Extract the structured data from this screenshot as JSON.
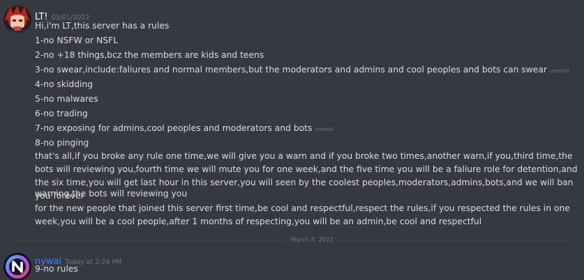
{
  "messages": [
    {
      "author": "LT!",
      "timestamp": "03/01/2022",
      "lines": [
        {
          "text": "Hi,i'm LT,this server has a rules",
          "edited": ""
        },
        {
          "text": "1-no NSFW or NSFL",
          "edited": ""
        },
        {
          "text": "2-no +18 things,bcz the members are kids and teens",
          "edited": ""
        },
        {
          "text": "3-no swear,include:faliures and normal members,but the moderators and admins and cool peoples and bots can swear",
          "edited": "(edited)"
        },
        {
          "text": "4-no skidding",
          "edited": ""
        },
        {
          "text": "5-no malwares",
          "edited": ""
        },
        {
          "text": "6-no trading",
          "edited": ""
        },
        {
          "text": "7-no exposing for admins,cool peoples and moderators and bots",
          "edited": "(edited)"
        },
        {
          "text": "8-no pinging",
          "edited": ""
        },
        {
          "text": "that's all,if you broke any rule one time,we will give you a warn and if you broke two times,another warn,if you,third time,the bots will reviewing you,fourth time we will mute you for one week,and the five time you will be a faliure role for detention,and the six time,you will get last hour in this server,you will seen by the coolest peoples,moderators,admins,bots,and we will ban you forever",
          "edited": ""
        },
        {
          "text": "warning,the bots will reviewing you",
          "edited": ""
        },
        {
          "text": "for the new people that joined this server first time,be cool and respectful,respect the rules,if you respected the rules in one week,you will be a cool people,after 1 months of respecting,you will be an admin,be cool and respectful",
          "edited": ""
        }
      ]
    },
    {
      "author": "nywal",
      "timestamp": "Today at 2:24 PM",
      "lines": [
        {
          "text": "9-no rules",
          "edited": ""
        }
      ]
    }
  ],
  "divider": {
    "label": "March 4, 2022"
  },
  "colors": {
    "background": "#36393f",
    "text": "#dcddde",
    "muted": "#72767d",
    "author_lt": "#ffffff",
    "author_nywal": "#3b82f6"
  },
  "icons": {
    "avatar_lt": "anime-character-avatar",
    "avatar_nywal": "neon-n-logo-avatar"
  }
}
